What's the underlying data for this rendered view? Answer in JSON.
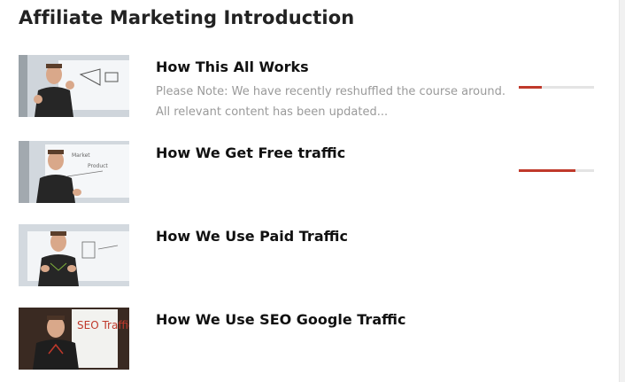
{
  "section": {
    "title": "Affiliate Marketing Introduction"
  },
  "lessons": [
    {
      "title": "How This All Works",
      "description": "Please Note: We have recently reshuffled the course around. All relevant content has been updated...",
      "progress": 0.3,
      "thumbnail_icon": "presenter-whiteboard-icon"
    },
    {
      "title": "How We Get Free traffic",
      "description": "",
      "progress": 0.75,
      "thumbnail_icon": "presenter-whiteboard-icon"
    },
    {
      "title": "How We Use Paid Traffic",
      "description": "",
      "progress": null,
      "thumbnail_icon": "presenter-whiteboard-icon"
    },
    {
      "title": "How We Use SEO Google Traffic",
      "description": "",
      "progress": null,
      "thumbnail_icon": "presenter-seo-board-icon",
      "thumbnail_text": "SEO Traffic"
    }
  ],
  "colors": {
    "accent": "#c0392b",
    "track": "#e4e4e4",
    "muted_text": "#9a9a9a"
  }
}
